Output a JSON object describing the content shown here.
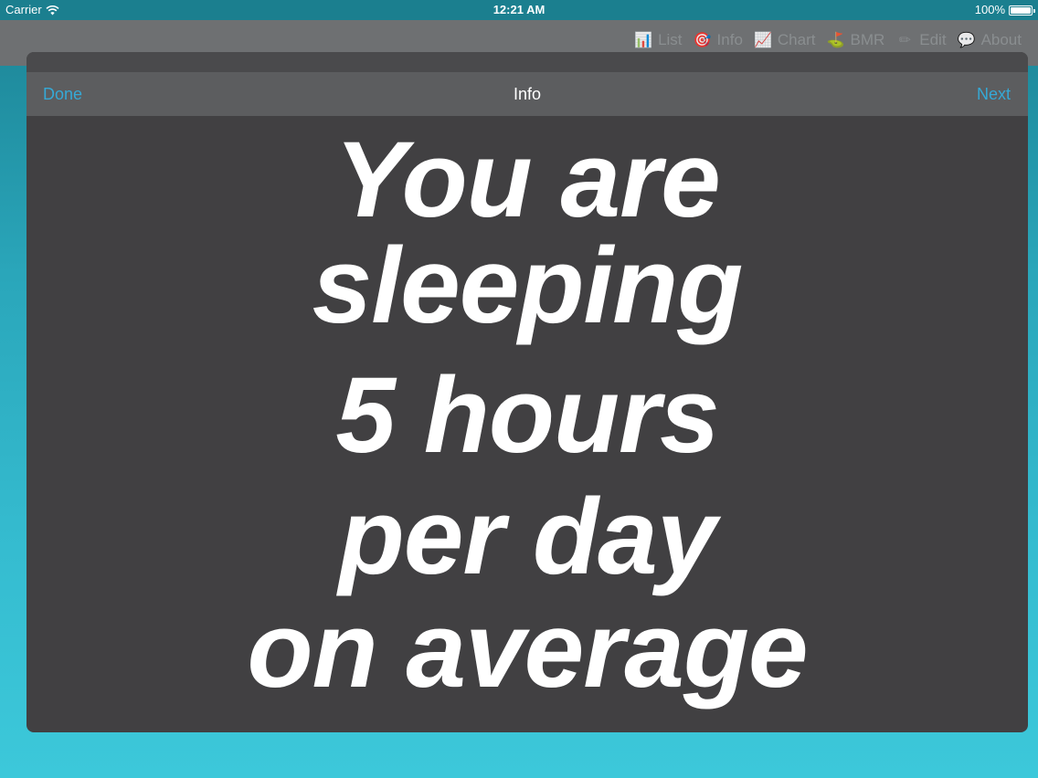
{
  "status_bar": {
    "carrier": "Carrier",
    "time": "12:21 AM",
    "battery": "100%"
  },
  "toolbar": {
    "items": [
      {
        "label": "List",
        "icon": "bar-chart-icon",
        "glyph": "📊"
      },
      {
        "label": "Info",
        "icon": "target-icon",
        "glyph": "🎯"
      },
      {
        "label": "Chart",
        "icon": "line-chart-icon",
        "glyph": "📈"
      },
      {
        "label": "BMR",
        "icon": "golf-icon",
        "glyph": "⛳"
      },
      {
        "label": "Edit",
        "icon": "pencil-icon",
        "glyph": "✏"
      },
      {
        "label": "About",
        "icon": "speech-bubble-icon",
        "glyph": "💬"
      }
    ]
  },
  "modal": {
    "done_label": "Done",
    "title": "Info",
    "next_label": "Next",
    "message_lines": [
      "You are",
      "sleeping",
      "5 hours",
      "per day",
      "on average"
    ]
  },
  "colors": {
    "accent": "#35a9d6",
    "modal_bg": "#414042",
    "navbar_bg": "#5c5d5f"
  }
}
